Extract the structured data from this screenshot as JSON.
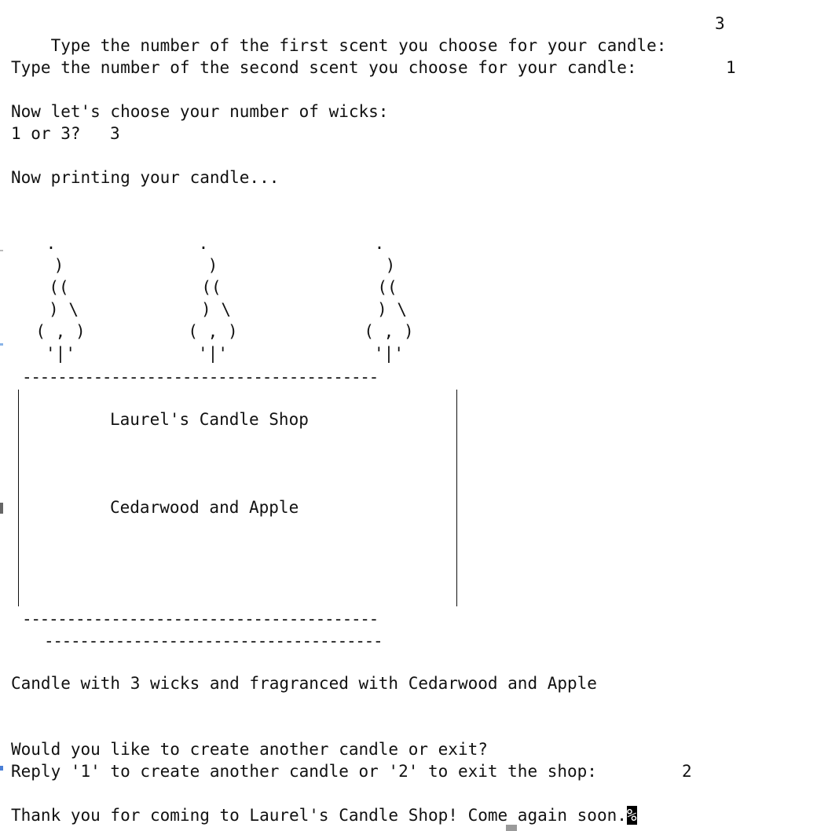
{
  "terminal": {
    "first_scent_prompt": "Type the number of the first scent you choose for your candle:",
    "first_scent_value": "3",
    "second_scent_prompt": "Type the number of the second scent you choose for your candle:",
    "second_scent_value": "1",
    "wick_header": "Now let's choose your number of wicks:",
    "wick_prompt": "1 or 3?",
    "wick_value": "3",
    "printing": "Now printing your candle...",
    "flame": {
      "dot": ".",
      "l1": ")",
      "l2": "((",
      "l3": ") \\",
      "l4": "( , )",
      "l5": "'|'"
    },
    "separator_top": "----------------------------------------",
    "shop_name": "Laurel's Candle Shop",
    "scent_label": "Cedarwood and Apple",
    "separator_bottom": "----------------------------------------",
    "separator_base": "--------------------------------------",
    "summary": "Candle with 3 wicks and fragranced with Cedarwood and Apple",
    "again_question": "Would you like to create another candle or exit?",
    "again_prompt": "Reply '1' to create another candle or '2' to exit the shop:",
    "again_value": "2",
    "goodbye": "Thank you for coming to Laurel's Candle Shop! Come again soon.",
    "cursor_char": "%"
  }
}
